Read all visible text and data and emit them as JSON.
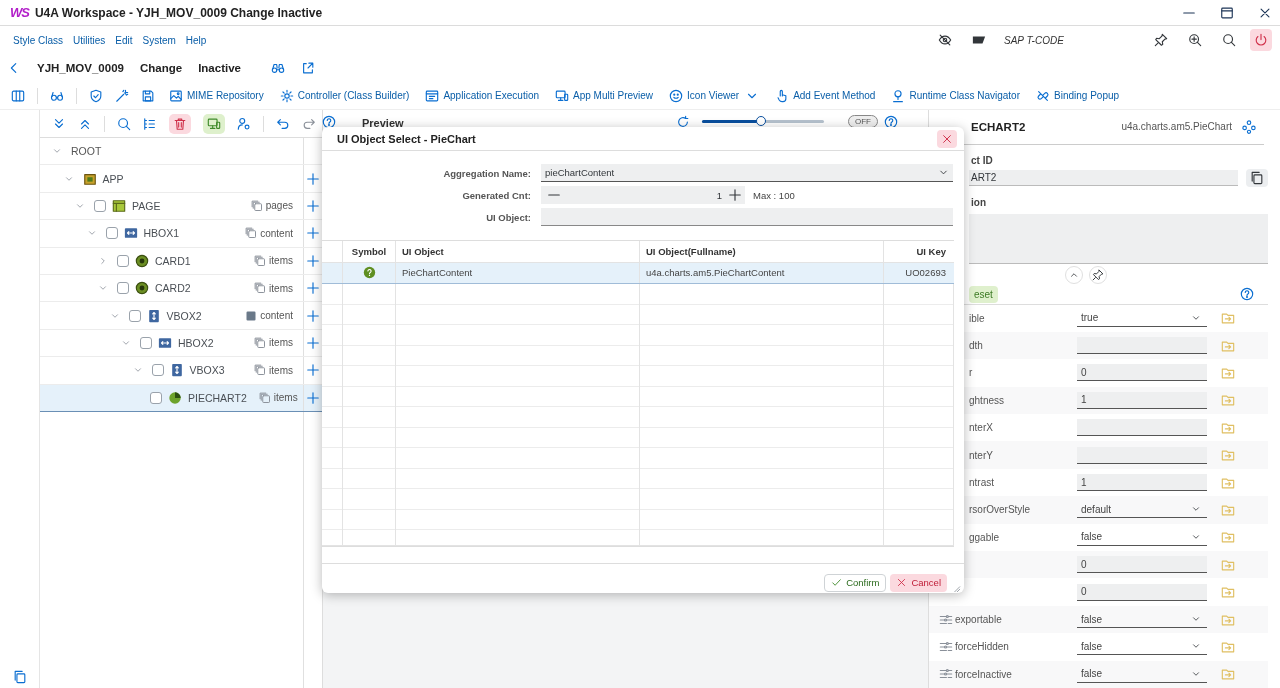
{
  "window": {
    "logo": "WS",
    "title": "U4A Workspace - YJH_MOV_0009 Change Inactive"
  },
  "menu_bar": {
    "items": [
      "Style Class",
      "Utilities",
      "Edit",
      "System",
      "Help"
    ],
    "tcode": {
      "placeholder": "SAP T-CODE"
    }
  },
  "header": {
    "app_id": "YJH_MOV_0009",
    "mode": "Change",
    "status": "Inactive"
  },
  "toolbar": {
    "items": [
      {
        "label": "MIME Repository"
      },
      {
        "label": "Controller (Class Builder)"
      },
      {
        "label": "Application Execution"
      },
      {
        "label": "App Multi Preview"
      },
      {
        "label": "Icon Viewer",
        "menu": true
      },
      {
        "label": "Add Event Method"
      },
      {
        "label": "Runtime Class Navigator"
      },
      {
        "label": "Binding Popup"
      }
    ]
  },
  "tree": {
    "nodes": [
      {
        "label": "ROOT",
        "expanded": true,
        "selected": false,
        "children": [
          {
            "label": "APP",
            "kind": "app",
            "expanded": true,
            "can_add": true,
            "selected": false,
            "children": [
              {
                "label": "PAGE",
                "kind": "page",
                "checked": false,
                "expanded": true,
                "aggregation": "pages",
                "multiple": true,
                "can_add": true,
                "selected": false,
                "children": [
                  {
                    "label": "HBOX1",
                    "kind": "hbox",
                    "checked": false,
                    "expanded": true,
                    "aggregation": "content",
                    "multiple": true,
                    "can_add": true,
                    "selected": false,
                    "children": [
                      {
                        "label": "CARD1",
                        "kind": "card",
                        "checked": false,
                        "expanded": false,
                        "aggregation": "items",
                        "multiple": true,
                        "can_add": true,
                        "selected": false
                      },
                      {
                        "label": "CARD2",
                        "kind": "card",
                        "checked": false,
                        "expanded": true,
                        "aggregation": "items",
                        "multiple": true,
                        "can_add": true,
                        "selected": false,
                        "children": [
                          {
                            "label": "VBOX2",
                            "kind": "vbox",
                            "checked": false,
                            "expanded": true,
                            "aggregation": "content",
                            "multiple": false,
                            "can_add": true,
                            "selected": false,
                            "children": [
                              {
                                "label": "HBOX2",
                                "kind": "hbox",
                                "checked": false,
                                "expanded": true,
                                "aggregation": "items",
                                "multiple": true,
                                "can_add": true,
                                "selected": false,
                                "children": [
                                  {
                                    "label": "VBOX3",
                                    "kind": "vbox",
                                    "checked": false,
                                    "expanded": true,
                                    "aggregation": "items",
                                    "multiple": true,
                                    "can_add": true,
                                    "selected": false,
                                    "children": [
                                      {
                                        "label": "PIECHART2",
                                        "kind": "chart",
                                        "checked": false,
                                        "aggregation": "items",
                                        "multiple": true,
                                        "can_add": true,
                                        "selected": true
                                      }
                                    ]
                                  }
                                ]
                              }
                            ]
                          }
                        ]
                      }
                    ]
                  }
                ]
              }
            ]
          }
        ]
      }
    ]
  },
  "preview": {
    "title": "Preview",
    "zoom": {
      "level": 0.48
    },
    "toggle": {
      "label": "OFF",
      "on": false
    }
  },
  "dialog": {
    "title": "UI Object Select - PieChart",
    "aggregation": {
      "label": "Aggregation Name:",
      "value": "pieChartContent"
    },
    "generated": {
      "label": "Generated Cnt:",
      "value": "1",
      "max": "Max : 100"
    },
    "ui_object": {
      "label": "UI Object:"
    },
    "table": {
      "columns": [
        "Symbol",
        "UI Object",
        "UI Object(Fullname)",
        "UI Key"
      ],
      "rows": [
        {
          "ui_object": "PieChartContent",
          "fullname": "u4a.charts.am5.PieChartContent",
          "ui_key": "UO02693",
          "selected": true
        }
      ]
    },
    "buttons": {
      "confirm": "Confirm",
      "cancel": "Cancel"
    }
  },
  "properties": {
    "title": "ECHART2",
    "class_name": "u4a.charts.am5.PieChart",
    "id_label": "ct ID",
    "id_value": "ART2",
    "desc_label": "ion",
    "reset": "eset",
    "rows": [
      {
        "label": "ible",
        "kind": "select",
        "value": "true",
        "has_icon": false
      },
      {
        "label": "dth",
        "kind": "input",
        "has_icon": false
      },
      {
        "label": "r",
        "kind": "input",
        "value": "0",
        "has_icon": false
      },
      {
        "label": "ghtness",
        "kind": "input",
        "value": "1",
        "has_icon": false
      },
      {
        "label": "nterX",
        "kind": "input",
        "has_icon": false
      },
      {
        "label": "nterY",
        "kind": "input",
        "has_icon": false
      },
      {
        "label": "ntrast",
        "kind": "input",
        "value": "1",
        "has_icon": false
      },
      {
        "label": "rsorOverStyle",
        "kind": "select",
        "value": "default",
        "has_icon": false
      },
      {
        "label": "ggable",
        "kind": "select",
        "value": "false",
        "has_icon": false
      },
      {
        "kind": "input",
        "value": "0",
        "has_icon": false
      },
      {
        "kind": "input",
        "value": "0",
        "has_icon": false
      },
      {
        "label": "exportable",
        "kind": "select",
        "value": "false",
        "has_icon": true
      },
      {
        "label": "forceHidden",
        "kind": "select",
        "value": "false",
        "has_icon": true
      },
      {
        "label": "forceInactive",
        "kind": "select",
        "value": "false",
        "has_icon": true
      }
    ]
  }
}
